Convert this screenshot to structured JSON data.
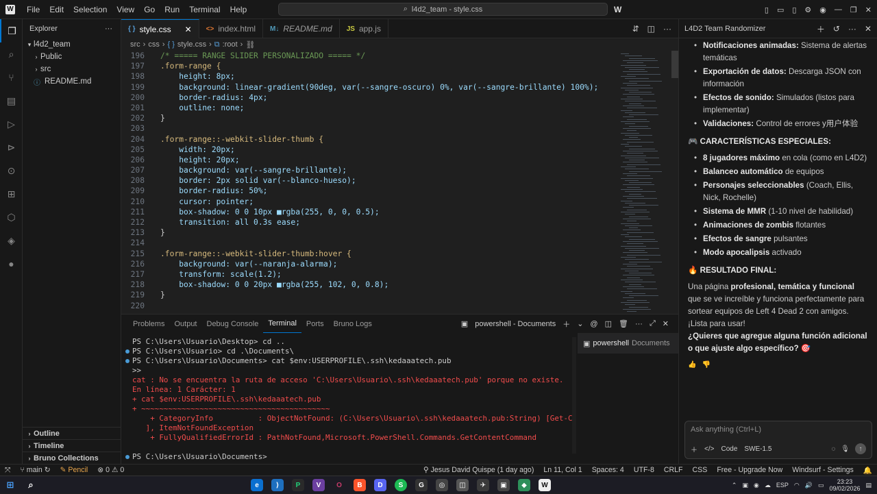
{
  "titlebar": {
    "menu": [
      "File",
      "Edit",
      "Selection",
      "View",
      "Go",
      "Run",
      "Terminal",
      "Help"
    ],
    "search_text": "l4d2_team - style.css"
  },
  "sidebar": {
    "title": "Explorer",
    "root": "l4d2_team",
    "items": [
      {
        "label": "Public",
        "type": "folder"
      },
      {
        "label": "src",
        "type": "folder"
      },
      {
        "label": "README.md",
        "type": "file"
      }
    ],
    "sections": [
      "Outline",
      "Timeline",
      "Bruno Collections"
    ]
  },
  "tabs": [
    {
      "label": "style.css",
      "icon": "{ }",
      "color": "#569cd6",
      "active": true
    },
    {
      "label": "index.html",
      "icon": "<>",
      "color": "#e37933",
      "active": false
    },
    {
      "label": "README.md",
      "icon": "M↓",
      "color": "#519aba",
      "active": false
    },
    {
      "label": "app.js",
      "icon": "JS",
      "color": "#cbcb41",
      "active": false
    }
  ],
  "breadcrumb": [
    "src",
    "css",
    "style.css",
    ":root"
  ],
  "code": [
    {
      "n": "196",
      "t": "/* ===== RANGE SLIDER PERSONALIZADO ===== */",
      "c": "#6a9955"
    },
    {
      "n": "197",
      "t": ".form-range {",
      "c": "#d7ba7d"
    },
    {
      "n": "198",
      "t": "    height: 8px;",
      "c": "#9cdcfe"
    },
    {
      "n": "199",
      "t": "    background: linear-gradient(90deg, var(--sangre-oscuro) 0%, var(--sangre-brillante) 100%);",
      "c": "#9cdcfe"
    },
    {
      "n": "200",
      "t": "    border-radius: 4px;",
      "c": "#9cdcfe"
    },
    {
      "n": "201",
      "t": "    outline: none;",
      "c": "#9cdcfe"
    },
    {
      "n": "202",
      "t": "}",
      "c": "#cccccc"
    },
    {
      "n": "203",
      "t": "",
      "c": "#cccccc"
    },
    {
      "n": "204",
      "t": ".form-range::-webkit-slider-thumb {",
      "c": "#d7ba7d"
    },
    {
      "n": "205",
      "t": "    width: 20px;",
      "c": "#9cdcfe"
    },
    {
      "n": "206",
      "t": "    height: 20px;",
      "c": "#9cdcfe"
    },
    {
      "n": "207",
      "t": "    background: var(--sangre-brillante);",
      "c": "#9cdcfe"
    },
    {
      "n": "208",
      "t": "    border: 2px solid var(--blanco-hueso);",
      "c": "#9cdcfe"
    },
    {
      "n": "209",
      "t": "    border-radius: 50%;",
      "c": "#9cdcfe"
    },
    {
      "n": "210",
      "t": "    cursor: pointer;",
      "c": "#9cdcfe"
    },
    {
      "n": "211",
      "t": "    box-shadow: 0 0 10px ■rgba(255, 0, 0, 0.5);",
      "c": "#9cdcfe"
    },
    {
      "n": "212",
      "t": "    transition: all 0.3s ease;",
      "c": "#9cdcfe"
    },
    {
      "n": "213",
      "t": "}",
      "c": "#cccccc"
    },
    {
      "n": "214",
      "t": "",
      "c": "#cccccc"
    },
    {
      "n": "215",
      "t": ".form-range::-webkit-slider-thumb:hover {",
      "c": "#d7ba7d"
    },
    {
      "n": "216",
      "t": "    background: var(--naranja-alarma);",
      "c": "#9cdcfe"
    },
    {
      "n": "217",
      "t": "    transform: scale(1.2);",
      "c": "#9cdcfe"
    },
    {
      "n": "218",
      "t": "    box-shadow: 0 0 20px ■rgba(255, 102, 0, 0.8);",
      "c": "#9cdcfe"
    },
    {
      "n": "219",
      "t": "}",
      "c": "#cccccc"
    },
    {
      "n": "220",
      "t": "",
      "c": "#cccccc"
    }
  ],
  "panel": {
    "tabs": [
      "Problems",
      "Output",
      "Debug Console",
      "Terminal",
      "Ports",
      "Bruno Logs"
    ],
    "active_tab": "Terminal",
    "terminal_name": "powershell - Documents",
    "terminal_list_item": "powershell",
    "terminal_list_sub": "Documents",
    "lines": [
      {
        "t": "PS C:\\Users\\Usuario\\Desktop> cd ..",
        "c": "#cccccc",
        "dot": false
      },
      {
        "t": "PS C:\\Users\\Usuario> cd .\\Documents\\",
        "c": "#cccccc",
        "dot": true
      },
      {
        "t": "PS C:\\Users\\Usuario\\Documents> cat $env:USERPROFILE\\.ssh\\kedaaatech.pub",
        "c": "#cccccc",
        "dot": true
      },
      {
        "t": ">>",
        "c": "#cccccc",
        "dot": false
      },
      {
        "t": "cat : No se encuentra la ruta de acceso 'C:\\Users\\Usuario\\.ssh\\kedaaatech.pub' porque no existe.",
        "c": "#f14c4c",
        "dot": false
      },
      {
        "t": "En línea: 1 Carácter: 1",
        "c": "#f14c4c",
        "dot": false
      },
      {
        "t": "+ cat $env:USERPROFILE\\.ssh\\kedaaatech.pub",
        "c": "#f14c4c",
        "dot": false
      },
      {
        "t": "+ ~~~~~~~~~~~~~~~~~~~~~~~~~~~~~~~~~~~~~~~~~~",
        "c": "#f14c4c",
        "dot": false
      },
      {
        "t": "    + CategoryInfo          : ObjectNotFound: (C:\\Users\\Usuario\\.ssh\\kedaaatech.pub:String) [Get-Content",
        "c": "#f14c4c",
        "dot": false
      },
      {
        "t": "   ], ItemNotFoundException",
        "c": "#f14c4c",
        "dot": false
      },
      {
        "t": "    + FullyQualifiedErrorId : PathNotFound,Microsoft.PowerShell.Commands.GetContentCommand",
        "c": "#f14c4c",
        "dot": false
      },
      {
        "t": "",
        "c": "#cccccc",
        "dot": false
      },
      {
        "t": "PS C:\\Users\\Usuario\\Documents> ",
        "c": "#cccccc",
        "dot": true
      }
    ]
  },
  "chat": {
    "title": "L4D2 Team Randomizer",
    "items1": [
      {
        "b": "Notificaciones animadas:",
        "t": " Sistema de alertas temáticas"
      },
      {
        "b": "Exportación de datos:",
        "t": " Descarga JSON con información"
      },
      {
        "b": "Efectos de sonido:",
        "t": " Simulados (listos para implementar)"
      },
      {
        "b": "Validaciones:",
        "t": " Control de errores y用户体验"
      }
    ],
    "heading2": "🎮 CARACTERÍSTICAS ESPECIALES:",
    "items2": [
      {
        "b": "8 jugadores máximo",
        "t": " en cola (como en L4D2)"
      },
      {
        "b": "Balanceo automático",
        "t": " de equipos"
      },
      {
        "b": "Personajes seleccionables",
        "t": " (Coach, Ellis, Nick, Rochelle)"
      },
      {
        "b": "Sistema de MMR",
        "t": " (1-10 nivel de habilidad)"
      },
      {
        "b": "Animaciones de zombis",
        "t": " flotantes"
      },
      {
        "b": "Efectos de sangre",
        "t": " pulsantes"
      },
      {
        "b": "Modo apocalipsis",
        "t": " activado"
      }
    ],
    "heading3": "🔥 RESULTADO FINAL:",
    "final_pre": "Una página ",
    "final_bold": "profesional, temática y funcional",
    "final_post": " que se ve increíble y funciona perfectamente para sortear equipos de Left 4 Dead 2 con amigos. ¡Lista para usar!",
    "question": "¿Quieres que agregue alguna función adicional o que ajuste algo específico? 🎯",
    "input_placeholder": "Ask anything (Ctrl+L)",
    "mode": "Code",
    "model": "SWE-1.5"
  },
  "statusbar": {
    "branch": "main",
    "pencil": "Pencil",
    "errors": "0",
    "warnings": "0",
    "blame": "Jesus David Quispe (1 day ago)",
    "position": "Ln 11, Col 1",
    "spaces": "Spaces: 4",
    "encoding": "UTF-8",
    "eol": "CRLF",
    "language": "CSS",
    "upgrade": "Free - Upgrade Now",
    "settings": "Windsurf - Settings"
  },
  "taskbar": {
    "lang": "ESP",
    "time": "23:23",
    "date": "09/02/2026"
  }
}
